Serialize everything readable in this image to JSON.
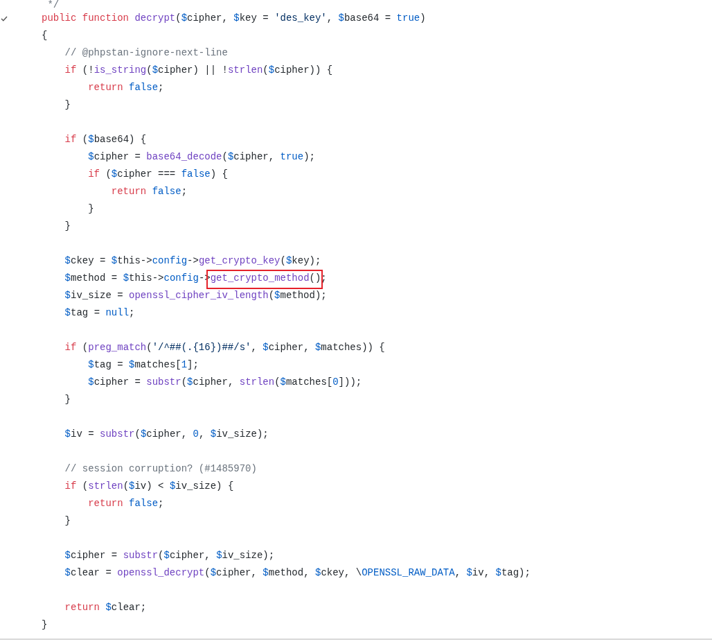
{
  "code_lines": [
    {
      "kind": "code",
      "checked": false,
      "tokens": [
        {
          "kind": "comment",
          "text": " */"
        }
      ]
    },
    {
      "kind": "code",
      "checked": true,
      "tokens": [
        {
          "kind": "keyword",
          "text": "public function "
        },
        {
          "kind": "function",
          "text": "decrypt"
        },
        {
          "kind": "plain",
          "text": "("
        },
        {
          "kind": "variable",
          "text": "$cipher"
        },
        {
          "kind": "plain",
          "text": ", "
        },
        {
          "kind": "variable",
          "text": "$key"
        },
        {
          "kind": "plain",
          "text": " = "
        },
        {
          "kind": "string",
          "text": "'des_key'"
        },
        {
          "kind": "plain",
          "text": ", "
        },
        {
          "kind": "variable",
          "text": "$base64"
        },
        {
          "kind": "plain",
          "text": " = "
        },
        {
          "kind": "constant",
          "text": "true"
        },
        {
          "kind": "plain",
          "text": ")"
        }
      ]
    },
    {
      "kind": "code",
      "checked": false,
      "tokens": [
        {
          "kind": "plain",
          "text": "{"
        }
      ]
    },
    {
      "kind": "code",
      "checked": false,
      "tokens": [
        {
          "kind": "comment",
          "text": "    // @phpstan-ignore-next-line"
        }
      ]
    },
    {
      "kind": "code",
      "checked": false,
      "tokens": [
        {
          "kind": "keyword",
          "text": "    if"
        },
        {
          "kind": "plain",
          "text": " (!"
        },
        {
          "kind": "function",
          "text": "is_string"
        },
        {
          "kind": "plain",
          "text": "("
        },
        {
          "kind": "variable",
          "text": "$cipher"
        },
        {
          "kind": "plain",
          "text": ") || !"
        },
        {
          "kind": "function",
          "text": "strlen"
        },
        {
          "kind": "plain",
          "text": "("
        },
        {
          "kind": "variable",
          "text": "$cipher"
        },
        {
          "kind": "plain",
          "text": ")) {"
        }
      ]
    },
    {
      "kind": "code",
      "checked": false,
      "tokens": [
        {
          "kind": "keyword",
          "text": "        return "
        },
        {
          "kind": "constant",
          "text": "false"
        },
        {
          "kind": "plain",
          "text": ";"
        }
      ]
    },
    {
      "kind": "code",
      "checked": false,
      "tokens": [
        {
          "kind": "plain",
          "text": "    }"
        }
      ]
    },
    {
      "kind": "blank",
      "checked": false
    },
    {
      "kind": "code",
      "checked": false,
      "tokens": [
        {
          "kind": "keyword",
          "text": "    if"
        },
        {
          "kind": "plain",
          "text": " ("
        },
        {
          "kind": "variable",
          "text": "$base64"
        },
        {
          "kind": "plain",
          "text": ") {"
        }
      ]
    },
    {
      "kind": "code",
      "checked": false,
      "tokens": [
        {
          "kind": "variable",
          "text": "        $cipher"
        },
        {
          "kind": "plain",
          "text": " = "
        },
        {
          "kind": "function",
          "text": "base64_decode"
        },
        {
          "kind": "plain",
          "text": "("
        },
        {
          "kind": "variable",
          "text": "$cipher"
        },
        {
          "kind": "plain",
          "text": ", "
        },
        {
          "kind": "constant",
          "text": "true"
        },
        {
          "kind": "plain",
          "text": ");"
        }
      ]
    },
    {
      "kind": "code",
      "checked": false,
      "tokens": [
        {
          "kind": "keyword",
          "text": "        if"
        },
        {
          "kind": "plain",
          "text": " ("
        },
        {
          "kind": "variable",
          "text": "$cipher"
        },
        {
          "kind": "plain",
          "text": " === "
        },
        {
          "kind": "constant",
          "text": "false"
        },
        {
          "kind": "plain",
          "text": ") {"
        }
      ]
    },
    {
      "kind": "code",
      "checked": false,
      "tokens": [
        {
          "kind": "keyword",
          "text": "            return "
        },
        {
          "kind": "constant",
          "text": "false"
        },
        {
          "kind": "plain",
          "text": ";"
        }
      ]
    },
    {
      "kind": "code",
      "checked": false,
      "tokens": [
        {
          "kind": "plain",
          "text": "        }"
        }
      ]
    },
    {
      "kind": "code",
      "checked": false,
      "tokens": [
        {
          "kind": "plain",
          "text": "    }"
        }
      ]
    },
    {
      "kind": "blank",
      "checked": false
    },
    {
      "kind": "code",
      "checked": false,
      "tokens": [
        {
          "kind": "variable",
          "text": "    $ckey"
        },
        {
          "kind": "plain",
          "text": " = "
        },
        {
          "kind": "variable",
          "text": "$this"
        },
        {
          "kind": "plain",
          "text": "->"
        },
        {
          "kind": "constant",
          "text": "config"
        },
        {
          "kind": "plain",
          "text": "->"
        },
        {
          "kind": "function",
          "text": "get_crypto_key"
        },
        {
          "kind": "plain",
          "text": "("
        },
        {
          "kind": "variable",
          "text": "$key"
        },
        {
          "kind": "plain",
          "text": ");"
        }
      ]
    },
    {
      "kind": "code",
      "checked": false,
      "tokens": [
        {
          "kind": "variable",
          "text": "    $method"
        },
        {
          "kind": "plain",
          "text": " = "
        },
        {
          "kind": "variable",
          "text": "$this"
        },
        {
          "kind": "plain",
          "text": "->"
        },
        {
          "kind": "constant",
          "text": "config"
        },
        {
          "kind": "plain",
          "text": "->"
        },
        {
          "kind": "function",
          "text": "get_crypto_method",
          "boxed": true
        },
        {
          "kind": "plain",
          "text": "()",
          "boxed": true
        },
        {
          "kind": "plain",
          "text": ";"
        }
      ]
    },
    {
      "kind": "code",
      "checked": false,
      "tokens": [
        {
          "kind": "variable",
          "text": "    $iv_size"
        },
        {
          "kind": "plain",
          "text": " = "
        },
        {
          "kind": "function",
          "text": "openssl_cipher_iv_length"
        },
        {
          "kind": "plain",
          "text": "("
        },
        {
          "kind": "variable",
          "text": "$method"
        },
        {
          "kind": "plain",
          "text": ");"
        }
      ]
    },
    {
      "kind": "code",
      "checked": false,
      "tokens": [
        {
          "kind": "variable",
          "text": "    $tag"
        },
        {
          "kind": "plain",
          "text": " = "
        },
        {
          "kind": "constant",
          "text": "null"
        },
        {
          "kind": "plain",
          "text": ";"
        }
      ]
    },
    {
      "kind": "blank",
      "checked": false
    },
    {
      "kind": "code",
      "checked": false,
      "tokens": [
        {
          "kind": "keyword",
          "text": "    if"
        },
        {
          "kind": "plain",
          "text": " ("
        },
        {
          "kind": "function",
          "text": "preg_match"
        },
        {
          "kind": "plain",
          "text": "("
        },
        {
          "kind": "string",
          "text": "'/^##(.{16})##/s'"
        },
        {
          "kind": "plain",
          "text": ", "
        },
        {
          "kind": "variable",
          "text": "$cipher"
        },
        {
          "kind": "plain",
          "text": ", "
        },
        {
          "kind": "variable",
          "text": "$matches"
        },
        {
          "kind": "plain",
          "text": ")) {"
        }
      ]
    },
    {
      "kind": "code",
      "checked": false,
      "tokens": [
        {
          "kind": "variable",
          "text": "        $tag"
        },
        {
          "kind": "plain",
          "text": " = "
        },
        {
          "kind": "variable",
          "text": "$matches"
        },
        {
          "kind": "plain",
          "text": "["
        },
        {
          "kind": "constant",
          "text": "1"
        },
        {
          "kind": "plain",
          "text": "];"
        }
      ]
    },
    {
      "kind": "code",
      "checked": false,
      "tokens": [
        {
          "kind": "variable",
          "text": "        $cipher"
        },
        {
          "kind": "plain",
          "text": " = "
        },
        {
          "kind": "function",
          "text": "substr"
        },
        {
          "kind": "plain",
          "text": "("
        },
        {
          "kind": "variable",
          "text": "$cipher"
        },
        {
          "kind": "plain",
          "text": ", "
        },
        {
          "kind": "function",
          "text": "strlen"
        },
        {
          "kind": "plain",
          "text": "("
        },
        {
          "kind": "variable",
          "text": "$matches"
        },
        {
          "kind": "plain",
          "text": "["
        },
        {
          "kind": "constant",
          "text": "0"
        },
        {
          "kind": "plain",
          "text": "]));"
        }
      ]
    },
    {
      "kind": "code",
      "checked": false,
      "tokens": [
        {
          "kind": "plain",
          "text": "    }"
        }
      ]
    },
    {
      "kind": "blank",
      "checked": false
    },
    {
      "kind": "code",
      "checked": false,
      "tokens": [
        {
          "kind": "variable",
          "text": "    $iv"
        },
        {
          "kind": "plain",
          "text": " = "
        },
        {
          "kind": "function",
          "text": "substr"
        },
        {
          "kind": "plain",
          "text": "("
        },
        {
          "kind": "variable",
          "text": "$cipher"
        },
        {
          "kind": "plain",
          "text": ", "
        },
        {
          "kind": "constant",
          "text": "0"
        },
        {
          "kind": "plain",
          "text": ", "
        },
        {
          "kind": "variable",
          "text": "$iv_size"
        },
        {
          "kind": "plain",
          "text": ");"
        }
      ]
    },
    {
      "kind": "blank",
      "checked": false
    },
    {
      "kind": "code",
      "checked": false,
      "tokens": [
        {
          "kind": "comment",
          "text": "    // session corruption? (#1485970)"
        }
      ]
    },
    {
      "kind": "code",
      "checked": false,
      "tokens": [
        {
          "kind": "keyword",
          "text": "    if"
        },
        {
          "kind": "plain",
          "text": " ("
        },
        {
          "kind": "function",
          "text": "strlen"
        },
        {
          "kind": "plain",
          "text": "("
        },
        {
          "kind": "variable",
          "text": "$iv"
        },
        {
          "kind": "plain",
          "text": ") < "
        },
        {
          "kind": "variable",
          "text": "$iv_size"
        },
        {
          "kind": "plain",
          "text": ") {"
        }
      ]
    },
    {
      "kind": "code",
      "checked": false,
      "tokens": [
        {
          "kind": "keyword",
          "text": "        return "
        },
        {
          "kind": "constant",
          "text": "false"
        },
        {
          "kind": "plain",
          "text": ";"
        }
      ]
    },
    {
      "kind": "code",
      "checked": false,
      "tokens": [
        {
          "kind": "plain",
          "text": "    }"
        }
      ]
    },
    {
      "kind": "blank",
      "checked": false
    },
    {
      "kind": "code",
      "checked": false,
      "tokens": [
        {
          "kind": "variable",
          "text": "    $cipher"
        },
        {
          "kind": "plain",
          "text": " = "
        },
        {
          "kind": "function",
          "text": "substr"
        },
        {
          "kind": "plain",
          "text": "("
        },
        {
          "kind": "variable",
          "text": "$cipher"
        },
        {
          "kind": "plain",
          "text": ", "
        },
        {
          "kind": "variable",
          "text": "$iv_size"
        },
        {
          "kind": "plain",
          "text": ");"
        }
      ]
    },
    {
      "kind": "code",
      "checked": false,
      "tokens": [
        {
          "kind": "variable",
          "text": "    $clear"
        },
        {
          "kind": "plain",
          "text": " = "
        },
        {
          "kind": "function",
          "text": "openssl_decrypt"
        },
        {
          "kind": "plain",
          "text": "("
        },
        {
          "kind": "variable",
          "text": "$cipher"
        },
        {
          "kind": "plain",
          "text": ", "
        },
        {
          "kind": "variable",
          "text": "$method"
        },
        {
          "kind": "plain",
          "text": ", "
        },
        {
          "kind": "variable",
          "text": "$ckey"
        },
        {
          "kind": "plain",
          "text": ", \\"
        },
        {
          "kind": "constant",
          "text": "OPENSSL_RAW_DATA"
        },
        {
          "kind": "plain",
          "text": ", "
        },
        {
          "kind": "variable",
          "text": "$iv"
        },
        {
          "kind": "plain",
          "text": ", "
        },
        {
          "kind": "variable",
          "text": "$tag"
        },
        {
          "kind": "plain",
          "text": ");"
        }
      ]
    },
    {
      "kind": "blank",
      "checked": false
    },
    {
      "kind": "code",
      "checked": false,
      "tokens": [
        {
          "kind": "keyword",
          "text": "    return "
        },
        {
          "kind": "variable",
          "text": "$clear"
        },
        {
          "kind": "plain",
          "text": ";"
        }
      ]
    },
    {
      "kind": "code",
      "checked": false,
      "tokens": [
        {
          "kind": "plain",
          "text": "}"
        }
      ]
    }
  ]
}
